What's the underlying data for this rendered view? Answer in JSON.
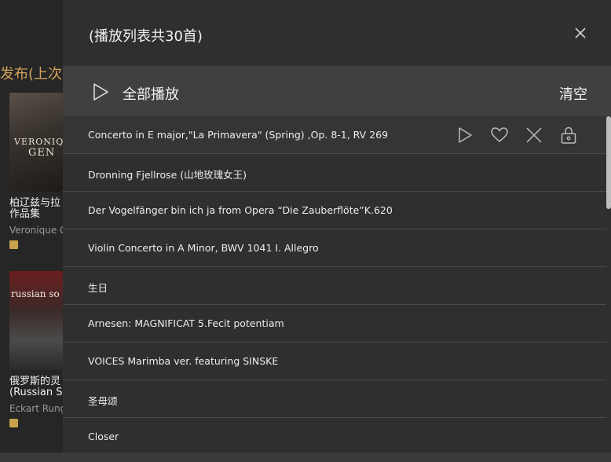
{
  "background": {
    "section_heading": "发布(上次更",
    "albums": [
      {
        "cover_text_line1": "VERONIQUE",
        "cover_text_line2": "GEN",
        "title_line1": "柏辽兹与拉",
        "title_line2": "作品集",
        "artist": "Veronique G"
      },
      {
        "cover_text_line1": "russian so",
        "title_line1": "俄罗斯的灵",
        "title_line2": "(Russian S",
        "artist": "Eckart Rung"
      }
    ]
  },
  "panel": {
    "title": "(播放列表共30首)",
    "play_all_label": "全部播放",
    "clear_label": "清空",
    "tracks": [
      "Concerto in E major,\"La Primavera\" (Spring) ,Op. 8-1, RV 269",
      "Dronning Fjellrose (山地玫瑰女王)",
      "Der Vogelfänger bin ich ja from Opera “Die Zauberflöte”K.620",
      "Violin Concerto in A Minor, BWV 1041 I. Allegro",
      "生日",
      "Arnesen: MAGNIFICAT 5.Fecit potentiam",
      "VOICES Marimba ver. featuring SINSKE",
      "圣母颂",
      "Closer"
    ],
    "row_action_icons": [
      "play-icon",
      "heart-icon",
      "remove-icon",
      "lock-icon"
    ]
  },
  "colors": {
    "panel_bg": "#2f2f2f",
    "toolbar_bg": "#404040",
    "accent_gold": "#d4a25a"
  }
}
